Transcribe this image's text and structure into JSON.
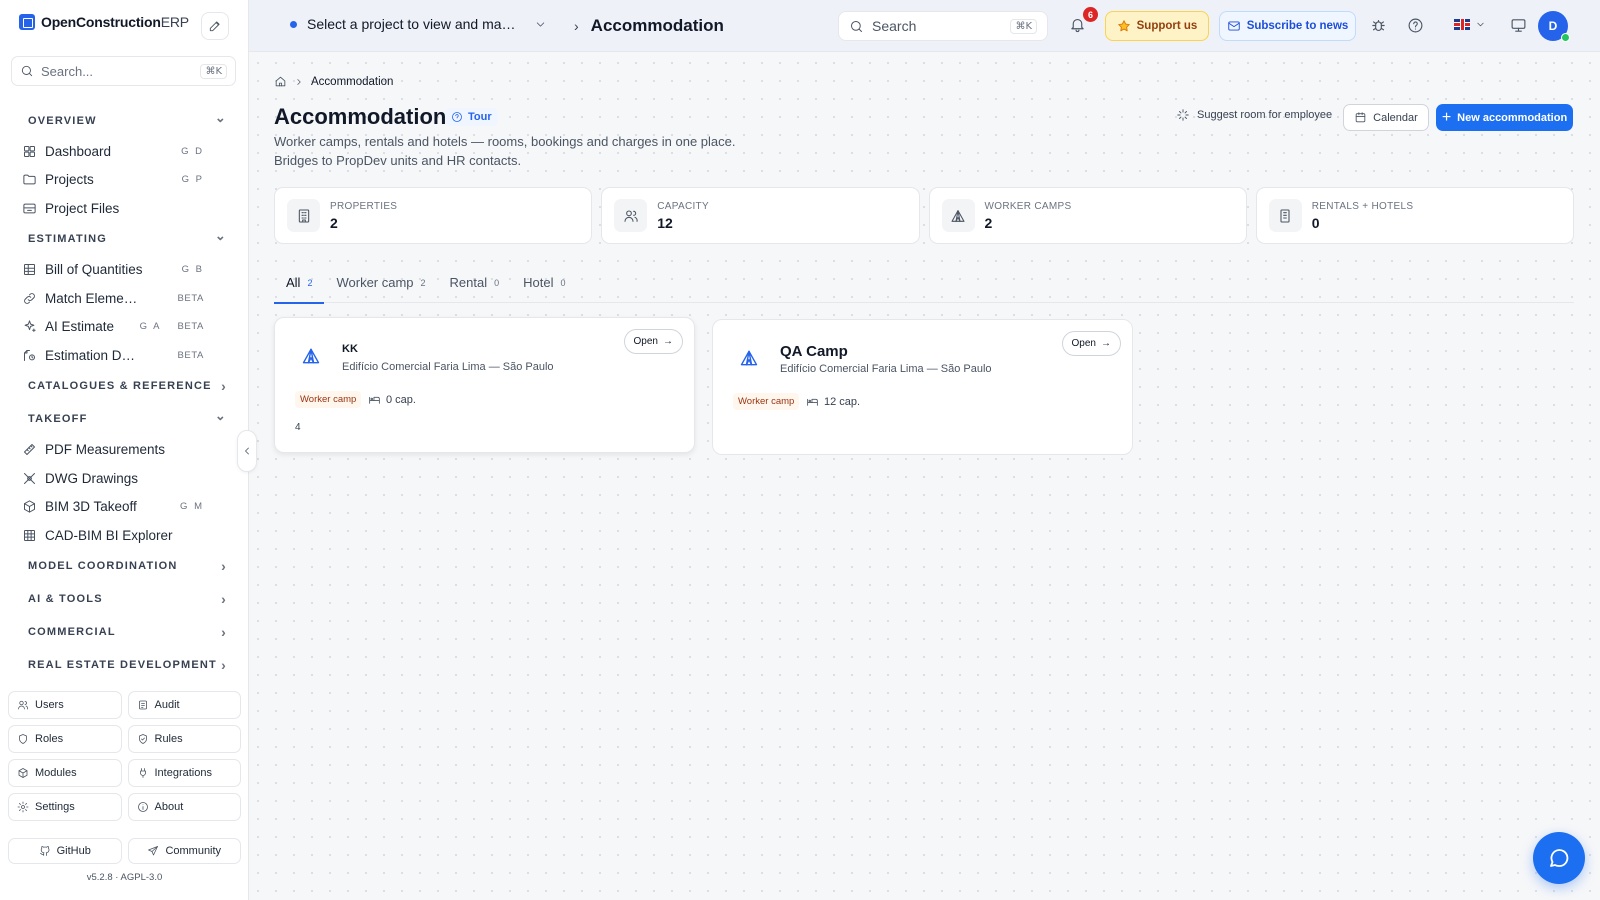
{
  "app": {
    "brand_main": "OpenConstruction",
    "brand_suffix": "ERP"
  },
  "sidebar": {
    "search_placeholder": "Search...",
    "search_shortcut": "⌘K",
    "sections": [
      {
        "title": "OVERVIEW",
        "expanded": true,
        "items": [
          {
            "label": "Dashboard",
            "shortcut": "G D",
            "icon": "dashboard-icon"
          },
          {
            "label": "Projects",
            "shortcut": "G P",
            "icon": "folder-icon"
          },
          {
            "label": "Project Files",
            "shortcut": "",
            "icon": "archive-icon"
          }
        ]
      },
      {
        "title": "ESTIMATING",
        "expanded": true,
        "items": [
          {
            "label": "Bill of Quantities",
            "shortcut": "G B",
            "icon": "table-icon"
          },
          {
            "label": "Match Eleme…",
            "badge": "BETA",
            "icon": "link-icon"
          },
          {
            "label": "AI Estimate",
            "shortcut": "G A",
            "badge": "BETA",
            "icon": "sparkles-icon"
          },
          {
            "label": "Estimation D…",
            "badge": "BETA",
            "icon": "estimation-icon"
          }
        ]
      },
      {
        "title": "CATALOGUES & REFERENCE",
        "expanded": false,
        "items": []
      },
      {
        "title": "TAKEOFF",
        "expanded": true,
        "items": [
          {
            "label": "PDF Measurements",
            "shortcut": "",
            "icon": "ruler-icon"
          },
          {
            "label": "DWG Drawings",
            "shortcut": "",
            "icon": "drawing-icon"
          },
          {
            "label": "BIM 3D Takeoff",
            "shortcut": "G M",
            "icon": "cube-icon"
          },
          {
            "label": "CAD-BIM BI Explorer",
            "shortcut": "",
            "icon": "grid-icon"
          }
        ]
      },
      {
        "title": "MODEL COORDINATION",
        "expanded": false,
        "items": []
      },
      {
        "title": "AI & TOOLS",
        "expanded": false,
        "items": []
      },
      {
        "title": "COMMERCIAL",
        "expanded": false,
        "items": []
      },
      {
        "title": "REAL ESTATE DEVELOPMENT",
        "expanded": false,
        "items": []
      }
    ],
    "admin": [
      {
        "label": "Users",
        "icon": "users-icon"
      },
      {
        "label": "Audit",
        "icon": "audit-icon"
      },
      {
        "label": "Roles",
        "icon": "shield-icon"
      },
      {
        "label": "Rules",
        "icon": "shield-check-icon"
      },
      {
        "label": "Modules",
        "icon": "package-icon"
      },
      {
        "label": "Integrations",
        "icon": "plug-icon"
      },
      {
        "label": "Settings",
        "icon": "gear-icon"
      },
      {
        "label": "About",
        "icon": "info-icon"
      }
    ],
    "links": [
      {
        "label": "GitHub",
        "icon": "github-icon"
      },
      {
        "label": "Community",
        "icon": "send-icon"
      }
    ],
    "version": "v5.2.8  ·  AGPL-3.0"
  },
  "topbar": {
    "project_selector": "Select a project to view and ma…",
    "title_sep": "›",
    "title": "Accommodation",
    "search_placeholder": "Search",
    "search_shortcut": "⌘K",
    "notifications": "6",
    "support": "Support us",
    "subscribe": "Subscribe to news",
    "avatar": "D"
  },
  "page": {
    "breadcrumb": "Accommodation",
    "title": "Accommodation",
    "tour": "Tour",
    "desc_line1": "Worker camps, rentals and hotels — rooms, bookings and charges in one place.",
    "desc_line2": "Bridges to PropDev units and HR contacts.",
    "suggest": "Suggest room for employee",
    "calendar": "Calendar",
    "new": "New accommodation"
  },
  "stats": [
    {
      "label": "PROPERTIES",
      "value": "2",
      "icon": "building-icon"
    },
    {
      "label": "CAPACITY",
      "value": "12",
      "icon": "users-icon"
    },
    {
      "label": "WORKER CAMPS",
      "value": "2",
      "icon": "tent-icon"
    },
    {
      "label": "RENTALS + HOTELS",
      "value": "0",
      "icon": "hotel-icon"
    }
  ],
  "tabs": [
    {
      "label": "All",
      "count": "2",
      "active": true
    },
    {
      "label": "Worker camp",
      "count": "2",
      "active": false
    },
    {
      "label": "Rental",
      "count": "0",
      "active": false
    },
    {
      "label": "Hotel",
      "count": "0",
      "active": false
    }
  ],
  "cards": [
    {
      "name": "KK",
      "address": "Edifício Comercial Faria Lima — São Paulo",
      "open": "Open",
      "type": "Worker camp",
      "capacity": "0 cap.",
      "extra": "4"
    },
    {
      "name": "QA Camp",
      "address": "Edifício Comercial Faria Lima — São Paulo",
      "open": "Open",
      "type": "Worker camp",
      "capacity": "12 cap.",
      "extra": ""
    }
  ],
  "colors": {
    "accent": "#2563eb",
    "primary_button": "#1d6ff2",
    "tag_bg": "#fff7ed",
    "tag_text": "#9a3412"
  }
}
